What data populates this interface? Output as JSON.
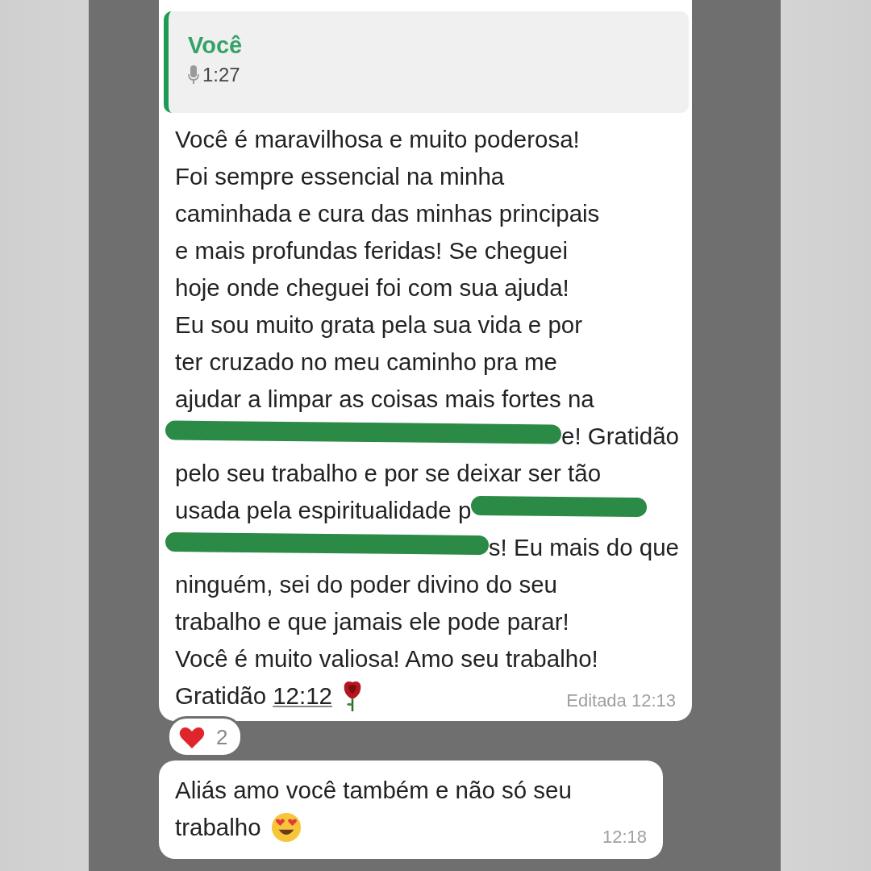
{
  "quoted": {
    "author": "Você",
    "duration": "1:27"
  },
  "message": {
    "lines": [
      [
        {
          "kind": "text",
          "text": "Você é maravilhosa e muito poderosa!"
        }
      ],
      [
        {
          "kind": "text",
          "text": "Foi sempre essencial na minha"
        }
      ],
      [
        {
          "kind": "text",
          "text": "caminhada e cura das minhas principais"
        }
      ],
      [
        {
          "kind": "text",
          "text": "e mais profundas feridas! Se cheguei"
        }
      ],
      [
        {
          "kind": "text",
          "text": "hoje onde cheguei foi com sua ajuda!"
        }
      ],
      [
        {
          "kind": "text",
          "text": "Eu sou muito grata pela sua vida e por"
        }
      ],
      [
        {
          "kind": "text",
          "text": "ter cruzado no meu caminho pra me"
        }
      ],
      [
        {
          "kind": "text",
          "text": "ajudar a limpar as coisas mais fortes na"
        }
      ],
      [
        {
          "kind": "redaction"
        },
        {
          "kind": "text",
          "text": "e! Gratidão"
        }
      ],
      [
        {
          "kind": "text",
          "text": "pelo seu trabalho e por se deixar ser tão"
        }
      ],
      [
        {
          "kind": "text",
          "text": "usada pela espiritualidade p"
        },
        {
          "kind": "redaction"
        }
      ],
      [
        {
          "kind": "redaction"
        },
        {
          "kind": "text",
          "text": "s! Eu mais do que"
        }
      ],
      [
        {
          "kind": "text",
          "text": "ninguém, sei do poder divino do seu"
        }
      ],
      [
        {
          "kind": "text",
          "text": "trabalho e que jamais ele pode parar!"
        }
      ],
      [
        {
          "kind": "text",
          "text": "Você é muito valiosa! Amo seu trabalho!"
        }
      ],
      [
        {
          "kind": "text",
          "text": "Gratidão"
        },
        {
          "kind": "time",
          "text": "12:12"
        }
      ]
    ],
    "meta": "Editada 12:13"
  },
  "reaction": {
    "count": "2"
  },
  "reply": {
    "lines": [
      "Aliás amo você também e não só seu",
      "trabalho"
    ],
    "time": "12:18"
  }
}
